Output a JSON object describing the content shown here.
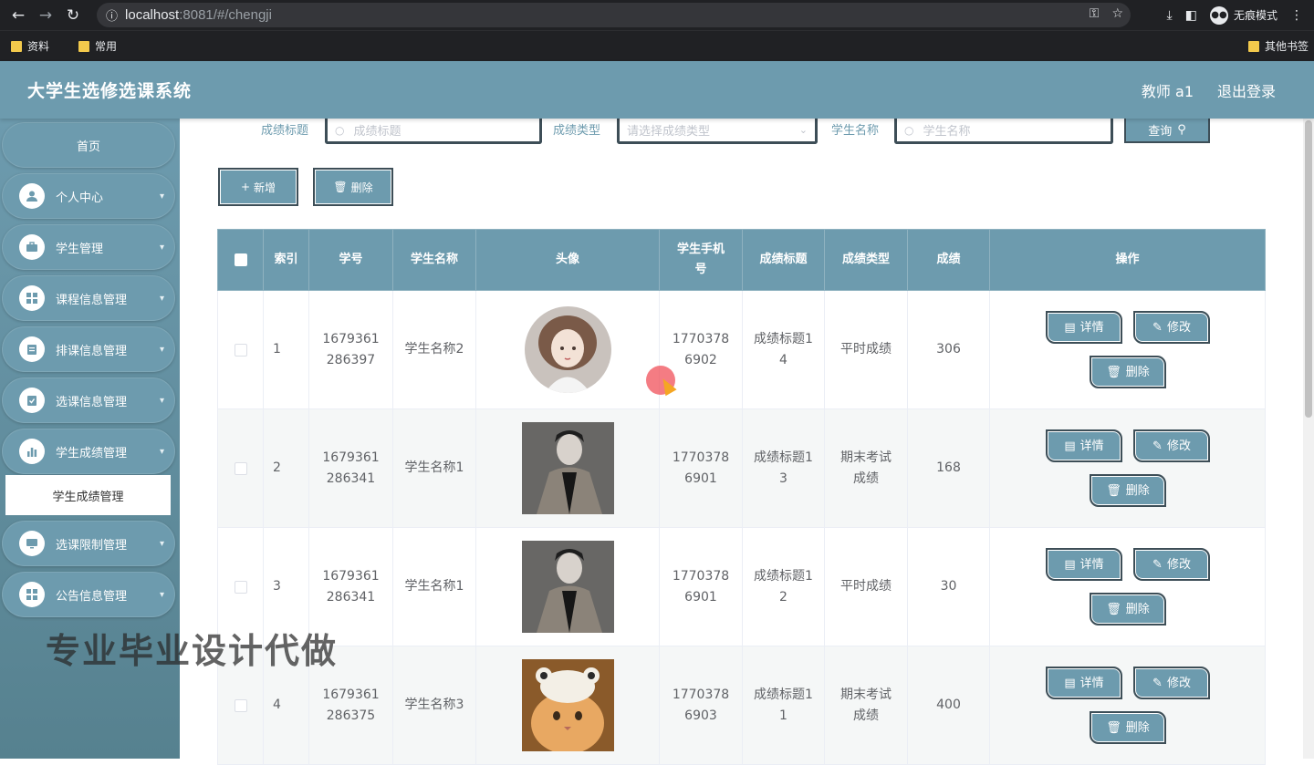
{
  "browser": {
    "url_host": "localhost",
    "url_rest": ":8081/#/chengji",
    "incognito_label": "无痕模式",
    "bookmarks": [
      "资料",
      "常用"
    ],
    "other_bookmarks": "其他书签"
  },
  "header": {
    "title": "大学生选修选课系统",
    "user": "教师 a1",
    "logout": "退出登录"
  },
  "sidebar": {
    "home": "首页",
    "items": [
      {
        "label": "个人中心",
        "icon": "user-icon"
      },
      {
        "label": "学生管理",
        "icon": "briefcase-icon"
      },
      {
        "label": "课程信息管理",
        "icon": "grid-icon"
      },
      {
        "label": "排课信息管理",
        "icon": "clipboard-icon"
      },
      {
        "label": "选课信息管理",
        "icon": "clipboard-check-icon"
      },
      {
        "label": "学生成绩管理",
        "icon": "bar-chart-icon"
      },
      {
        "label": "选课限制管理",
        "icon": "monitor-icon"
      },
      {
        "label": "公告信息管理",
        "icon": "grid-icon"
      }
    ],
    "active_sub": "学生成绩管理"
  },
  "search": {
    "title_label": "成绩标题",
    "title_placeholder": "成绩标题",
    "type_label": "成绩类型",
    "type_placeholder": "请选择成绩类型",
    "student_label": "学生名称",
    "student_placeholder": "学生名称",
    "query_button": "查询"
  },
  "actions": {
    "add": "新增",
    "delete": "删除"
  },
  "table": {
    "headers": [
      "索引",
      "学号",
      "学生名称",
      "头像",
      "学生手机号",
      "成绩标题",
      "成绩类型",
      "成绩",
      "操作"
    ],
    "rows": [
      {
        "index": "1",
        "student_no": "1679361286397",
        "name": "学生名称2",
        "phone": "17703786902",
        "title": "成绩标题14",
        "type": "平时成绩",
        "score": "306",
        "avatar": "illustrated-girl"
      },
      {
        "index": "2",
        "student_no": "1679361286341",
        "name": "学生名称1",
        "phone": "17703786901",
        "title": "成绩标题13",
        "type": "期末考试成绩",
        "score": "168",
        "avatar": "man-in-coat"
      },
      {
        "index": "3",
        "student_no": "1679361286341",
        "name": "学生名称1",
        "phone": "17703786901",
        "title": "成绩标题12",
        "type": "平时成绩",
        "score": "30",
        "avatar": "man-in-coat"
      },
      {
        "index": "4",
        "student_no": "1679361286375",
        "name": "学生名称3",
        "phone": "17703786903",
        "title": "成绩标题11",
        "type": "期末考试成绩",
        "score": "400",
        "avatar": "cat-with-hat"
      }
    ],
    "op_detail": "详情",
    "op_edit": "修改",
    "op_delete": "删除"
  },
  "watermark": "专业毕业设计代做",
  "colors": {
    "accent": "#6d9bae",
    "border_dark": "#3d4e57"
  }
}
